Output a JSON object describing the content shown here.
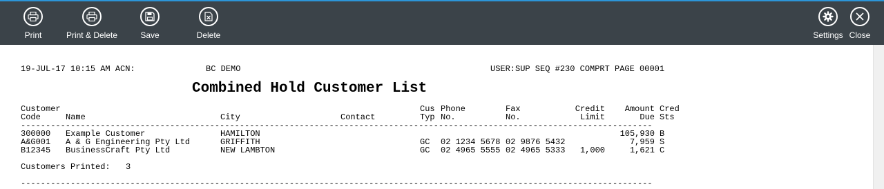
{
  "toolbar": {
    "print": "Print",
    "print_delete": "Print & Delete",
    "save": "Save",
    "delete": "Delete",
    "settings": "Settings",
    "close": "Close",
    "icons": [
      "printer-icon",
      "print-delete-icon",
      "save-icon",
      "delete-icon",
      "gear-icon",
      "close-icon"
    ]
  },
  "report": {
    "header_date": "19-JUL-17 10:15 AM ACN:",
    "header_company": "BC DEMO",
    "header_user": "USER:SUP SEQ #230 COMPRT PAGE 00001",
    "title": "Combined Hold Customer List",
    "columns": {
      "customer_code": [
        "Customer",
        "Code"
      ],
      "name": "Name",
      "city": "City",
      "contact": "Contact",
      "cus_typ": [
        "Cus",
        "Typ"
      ],
      "phone": [
        "Phone",
        "No."
      ],
      "fax": [
        "Fax",
        "No."
      ],
      "credit_limit": [
        "Credit",
        "Limit"
      ],
      "amount_due": [
        "Amount",
        "Due"
      ],
      "cred_sts": [
        "Cred",
        "Sts"
      ]
    },
    "rows": [
      {
        "code": "300000",
        "name": "Example Customer",
        "city": "HAMILTON",
        "contact": "",
        "typ": "",
        "phone": "",
        "fax": "",
        "limit": "",
        "due": "105,930",
        "sts": "B"
      },
      {
        "code": "A&G001",
        "name": "A & G Engineering Pty Ltd",
        "city": "GRIFFITH",
        "contact": "",
        "typ": "GC",
        "phone": "02 1234 5678",
        "fax": "02 9876 5432",
        "limit": "",
        "due": "7,959",
        "sts": "S"
      },
      {
        "code": "B12345",
        "name": "BusinessCraft Pty Ltd",
        "city": "NEW LAMBTON",
        "contact": "",
        "typ": "GC",
        "phone": "02 4965 5555",
        "fax": "02 4965 5333",
        "limit": "1,000",
        "due": "1,621",
        "sts": "C"
      }
    ],
    "footer_label": "Customers Printed:",
    "footer_count": "3",
    "separator": "-------------------------------------------------------------------------------------------------------------------------------"
  }
}
